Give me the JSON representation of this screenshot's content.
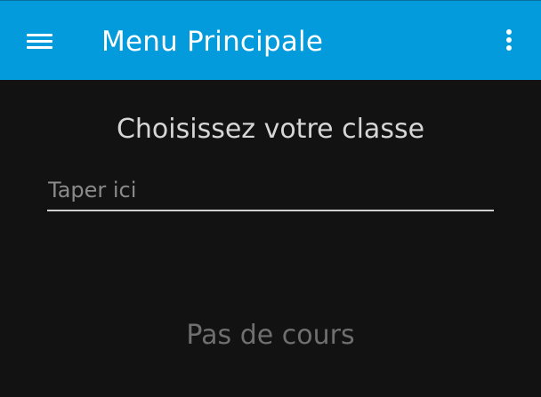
{
  "toolbar": {
    "title": "Menu Principale",
    "menu_icon": "hamburger-menu-icon",
    "more_icon": "more-vertical-icon",
    "background_color": "#039BDB"
  },
  "main": {
    "heading": "Choisissez votre classe",
    "search": {
      "placeholder": "Taper ici",
      "value": ""
    },
    "empty_message": "Pas de cours"
  }
}
